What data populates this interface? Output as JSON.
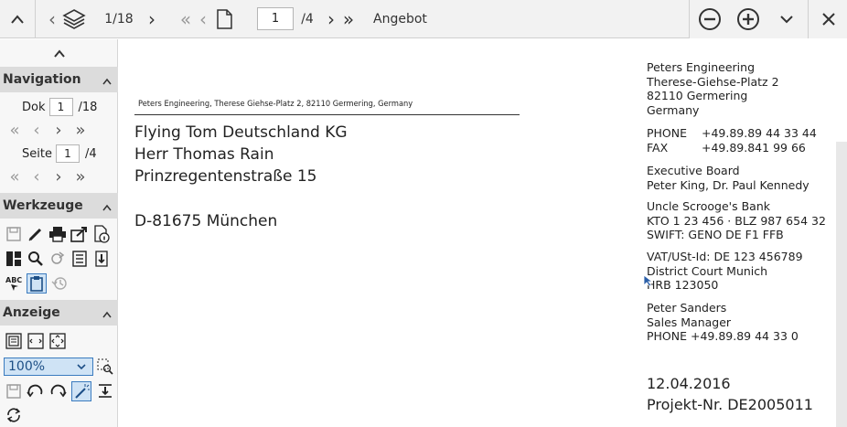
{
  "toolbar": {
    "doc_counter": "1/18",
    "page_value": "1",
    "page_total": "/4",
    "doc_title": "Angebot"
  },
  "sidebar": {
    "navigation": {
      "title": "Navigation",
      "dok_label": "Dok",
      "dok_value": "1",
      "dok_total": "/18",
      "seite_label": "Seite",
      "seite_value": "1",
      "seite_total": "/4"
    },
    "werkzeuge": {
      "title": "Werkzeuge"
    },
    "anzeige": {
      "title": "Anzeige",
      "zoom": "100%"
    }
  },
  "document": {
    "sender_line": "Peters Engineering, Therese Giehse-Platz 2, 82110 Germering, Germany",
    "recipient": [
      "Flying Tom Deutschland KG",
      "Herr Thomas Rain",
      "Prinzregentenstraße 15"
    ],
    "recipient_city": "D-81675 München",
    "company": [
      "Peters Engineering",
      "Therese-Giehse-Platz 2",
      "82110 Germering",
      "Germany"
    ],
    "contact": [
      {
        "label": "PHONE",
        "value": "+49.89.89 44 33 44"
      },
      {
        "label": "FAX",
        "value": "+49.89.841 99 66"
      }
    ],
    "board": [
      "Executive Board",
      "Peter King, Dr. Paul Kennedy"
    ],
    "bank": [
      "Uncle Scrooge's Bank",
      "KTO 1 23 456 · BLZ 987 654 32",
      "SWIFT: GENO DE F1 FFB"
    ],
    "legal": [
      "VAT/USt-Id: DE 123 456789",
      "District Court Munich",
      "HRB 123050"
    ],
    "person": [
      "Peter Sanders",
      "Sales Manager",
      "PHONE +49.89.89 44 33 0"
    ],
    "date": "12.04.2016",
    "project": "Projekt-Nr. DE2005011"
  }
}
